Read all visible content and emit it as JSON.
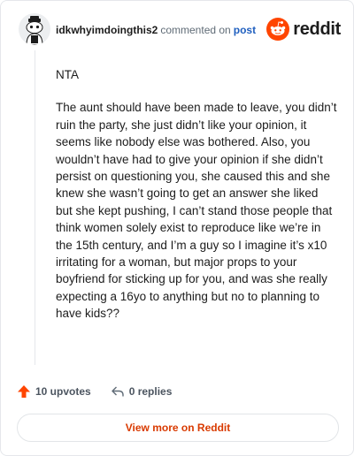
{
  "comment": {
    "username": "idkwhyimdoingthis2",
    "action_text": "commented on",
    "post_link": "post",
    "paragraphs": [
      "NTA",
      "The aunt should have been made to leave, you didn’t ruin the party, she just didn’t like your opinion, it seems like nobody else was bothered. Also, you wouldn’t have had to give your opinion if she didn’t persist on questioning you, she caused this and she knew she wasn’t going to get an answer she liked but she kept pushing, I can’t stand those people that think women solely exist to reproduce like we’re in the 15th century, and I’m a guy so I imagine it’s x10 irritating for a woman, but major props to your boyfriend for sticking up for you, and was she really expecting a 16yo to anything but no to planning to have kids??"
    ],
    "upvotes": "10 upvotes",
    "replies": "0 replies"
  },
  "brand": {
    "wordmark": "reddit",
    "color": "#ff4500"
  },
  "view_more_label": "View more on Reddit",
  "icons": {
    "avatar": "snoo-avatar",
    "upvote": "upvote-arrow-icon",
    "reply": "reply-arrow-icon",
    "logo": "reddit-logo-icon"
  },
  "colors": {
    "accent_text": "#d93a00",
    "link": "#1f5fbf",
    "upvote": "#ff4500"
  }
}
